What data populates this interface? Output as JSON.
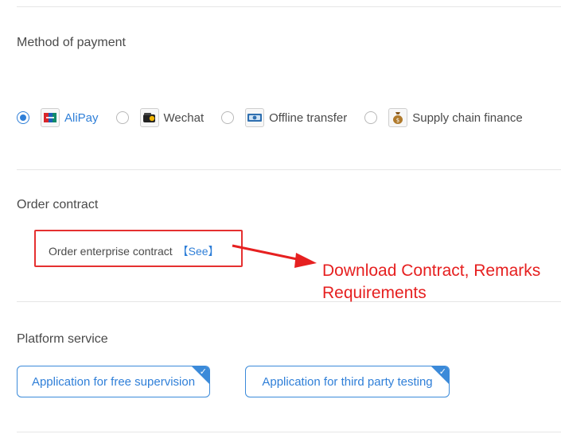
{
  "payment": {
    "title": "Method of payment",
    "options": [
      {
        "label": "AliPay",
        "icon": "bank-card-icon",
        "selected": true
      },
      {
        "label": "Wechat",
        "icon": "wechat-wallet-icon",
        "selected": false
      },
      {
        "label": "Offline transfer",
        "icon": "cash-transfer-icon",
        "selected": false
      },
      {
        "label": "Supply chain finance",
        "icon": "money-bag-icon",
        "selected": false
      }
    ]
  },
  "contract": {
    "title": "Order contract",
    "text": "Order enterprise contract",
    "see_link": "【See】"
  },
  "annotation": {
    "text": "Download Contract, Remarks Requirements",
    "color": "#e62020"
  },
  "platform_service": {
    "title": "Platform service",
    "buttons": [
      {
        "label": "Application for free supervision",
        "checked": true
      },
      {
        "label": "Application for third party testing",
        "checked": true
      }
    ]
  },
  "colors": {
    "accent": "#2f7fd8",
    "highlight_border": "#e53030"
  }
}
